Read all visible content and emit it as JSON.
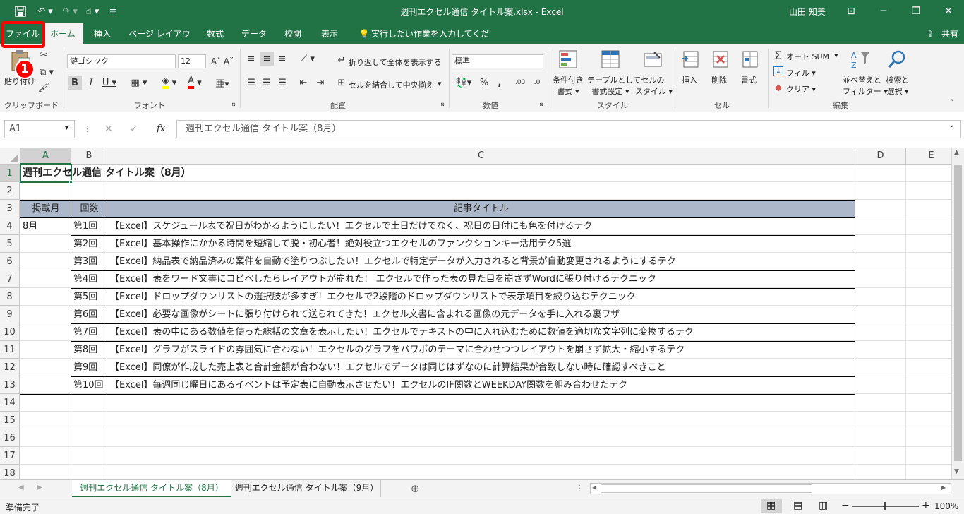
{
  "window": {
    "title": "週刊エクセル通信 タイトル案.xlsx - Excel",
    "user": "山田 知美"
  },
  "tabs": [
    "ファイル",
    "ホーム",
    "挿入",
    "ページ レイアウト",
    "数式",
    "データ",
    "校閲",
    "表示"
  ],
  "tell_me": "実行したい作業を入力してください",
  "share": "共有",
  "step_badge": "1",
  "ribbon": {
    "clipboard": {
      "paste": "貼り付け",
      "label": "クリップボード"
    },
    "font": {
      "name": "游ゴシック",
      "size": "12",
      "label": "フォント"
    },
    "alignment": {
      "wrap": "折り返して全体を表示する",
      "merge": "セルを結合して中央揃え",
      "label": "配置"
    },
    "number": {
      "format": "標準",
      "label": "数値"
    },
    "styles": {
      "conditional": [
        "条件付き",
        "書式"
      ],
      "table": [
        "テーブルとして",
        "書式設定"
      ],
      "cell": [
        "セルの",
        "スタイル"
      ],
      "label": "スタイル"
    },
    "cells": {
      "insert": "挿入",
      "delete": "削除",
      "format": "書式",
      "label": "セル"
    },
    "editing": {
      "autosum": "オート SUM",
      "fill": "フィル",
      "clear": "クリア",
      "sort": [
        "並べ替えと",
        "フィルター"
      ],
      "find": [
        "検索と",
        "選択"
      ],
      "label": "編集"
    }
  },
  "formula_bar": {
    "name_box": "A1",
    "formula": "週刊エクセル通信 タイトル案（8月）"
  },
  "columns": [
    "A",
    "B",
    "C",
    "D",
    "E"
  ],
  "rows": [
    "1",
    "2",
    "3",
    "4",
    "5",
    "6",
    "7",
    "8",
    "9",
    "10",
    "11",
    "12",
    "13",
    "14",
    "15",
    "16",
    "17",
    "18"
  ],
  "sheet": {
    "title": "週刊エクセル通信 タイトル案（8月）",
    "headers": [
      "掲載月",
      "回数",
      "記事タイトル"
    ],
    "month": "8月",
    "entries": [
      {
        "num": "第1回",
        "title": "【Excel】スケジュール表で祝日がわかるようにしたい！エクセルで土日だけでなく、祝日の日付にも色を付けるテク"
      },
      {
        "num": "第2回",
        "title": "【Excel】基本操作にかかる時間を短縮して脱・初心者！絶対役立つエクセルのファンクションキー活用テク5選"
      },
      {
        "num": "第3回",
        "title": "【Excel】納品表で納品済みの案件を自動で塗りつぶしたい！エクセルで特定データが入力されると背景が自動変更されるようにするテク"
      },
      {
        "num": "第4回",
        "title": "【Excel】表をワード文書にコピペしたらレイアウトが崩れた！ エクセルで作った表の見た目を崩さずWordに張り付けるテクニック"
      },
      {
        "num": "第5回",
        "title": "【Excel】ドロップダウンリストの選択肢が多すぎ！エクセルで2段階のドロップダウンリストで表示項目を絞り込むテクニック"
      },
      {
        "num": "第6回",
        "title": "【Excel】必要な画像がシートに張り付けられて送られてきた！エクセル文書に含まれる画像の元データを手に入れる裏ワザ"
      },
      {
        "num": "第7回",
        "title": "【Excel】表の中にある数値を使った総括の文章を表示したい！エクセルでテキストの中に入れ込むために数値を適切な文字列に変換するテク"
      },
      {
        "num": "第8回",
        "title": "【Excel】グラフがスライドの雰囲気に合わない！エクセルのグラフをパワポのテーマに合わせつつレイアウトを崩さず拡大・縮小するテク"
      },
      {
        "num": "第9回",
        "title": "【Excel】同僚が作成した売上表と合計金額が合わない！エクセルでデータは同じはずなのに計算結果が合致しない時に確認すべきこと"
      },
      {
        "num": "第10回",
        "title": "【Excel】毎週同じ曜日にあるイベントは予定表に自動表示させたい！エクセルのIF関数とWEEKDAY関数を組み合わせたテク"
      }
    ]
  },
  "sheet_tabs": [
    "週刊エクセル通信 タイトル案（8月）",
    "週刊エクセル通信 タイトル案（9月）"
  ],
  "status": {
    "ready": "準備完了",
    "zoom": "100%"
  },
  "colors": {
    "accent": "#217346",
    "header_fill": "#adb9ca",
    "highlight": "#ff0000"
  }
}
